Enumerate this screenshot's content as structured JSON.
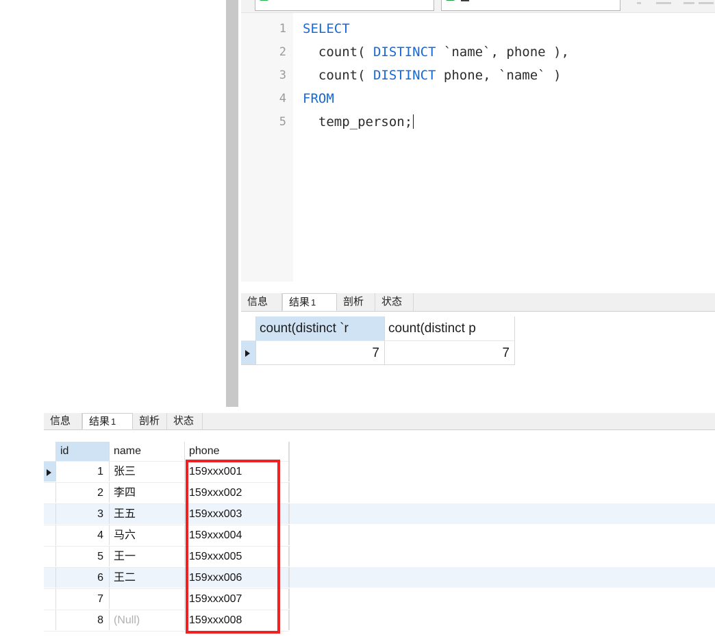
{
  "editor": {
    "toolbar": {
      "run_icon": "green-run-icon",
      "stop_icon": "green-stop-icon",
      "field1_value": "",
      "field2_value": "_"
    },
    "line_numbers": [
      "1",
      "2",
      "3",
      "4",
      "5"
    ],
    "code_lines": [
      [
        {
          "t": "SELECT",
          "kw": true
        }
      ],
      [
        {
          "t": "  count( ",
          "kw": false
        },
        {
          "t": "DISTINCT",
          "kw": true
        },
        {
          "t": " `name`, phone ),",
          "kw": false
        }
      ],
      [
        {
          "t": "  count( ",
          "kw": false
        },
        {
          "t": "DISTINCT",
          "kw": true
        },
        {
          "t": " phone, `name` )",
          "kw": false
        }
      ],
      [
        {
          "t": "FROM",
          "kw": true
        }
      ],
      [
        {
          "t": "  temp_person;",
          "kw": false
        }
      ]
    ],
    "code_plain": [
      "SELECT",
      "  count( DISTINCT `name`, phone ),",
      "  count( DISTINCT phone, `name` )",
      "FROM",
      "  temp_person;"
    ]
  },
  "upper_result": {
    "tabs": [
      {
        "label": "信息",
        "active": false
      },
      {
        "label": "结果",
        "num": "1",
        "active": true
      },
      {
        "label": "剖析",
        "active": false
      },
      {
        "label": "状态",
        "active": false
      }
    ],
    "columns": [
      "count(distinct `r",
      "count(distinct p"
    ],
    "rows": [
      {
        "selected": true,
        "values": [
          "7",
          "7"
        ]
      }
    ]
  },
  "lower_result": {
    "tabs": [
      {
        "label": "信息",
        "active": false
      },
      {
        "label": "结果",
        "num": "1",
        "active": true
      },
      {
        "label": "剖析",
        "active": false
      },
      {
        "label": "状态",
        "active": false
      }
    ],
    "columns": [
      "id",
      "name",
      "phone"
    ],
    "rows": [
      {
        "id": "1",
        "name": "张三",
        "phone": "159xxx001",
        "null_name": false,
        "alt": false,
        "current": true
      },
      {
        "id": "2",
        "name": "李四",
        "phone": "159xxx002",
        "null_name": false,
        "alt": false,
        "current": false
      },
      {
        "id": "3",
        "name": "王五",
        "phone": "159xxx003",
        "null_name": false,
        "alt": true,
        "current": false
      },
      {
        "id": "4",
        "name": "马六",
        "phone": "159xxx004",
        "null_name": false,
        "alt": false,
        "current": false
      },
      {
        "id": "5",
        "name": "王一",
        "phone": "159xxx005",
        "null_name": false,
        "alt": false,
        "current": false
      },
      {
        "id": "6",
        "name": "王二",
        "phone": "159xxx006",
        "null_name": false,
        "alt": true,
        "current": false
      },
      {
        "id": "7",
        "name": "",
        "phone": "159xxx007",
        "null_name": false,
        "alt": false,
        "current": false
      },
      {
        "id": "8",
        "name": "(Null)",
        "phone": "159xxx008",
        "null_name": true,
        "alt": false,
        "current": false
      }
    ],
    "highlight": {
      "color": "#ee2222",
      "target_column": "phone"
    }
  },
  "colors": {
    "keyword": "#1569d6",
    "code_text": "#2b2b2b",
    "gutter_text": "#9a9a9a",
    "selected_header": "#cfe3f5",
    "alt_row": "#eef4fb",
    "highlight_red": "#ee2222",
    "rail_gray": "#c8c8c8"
  }
}
